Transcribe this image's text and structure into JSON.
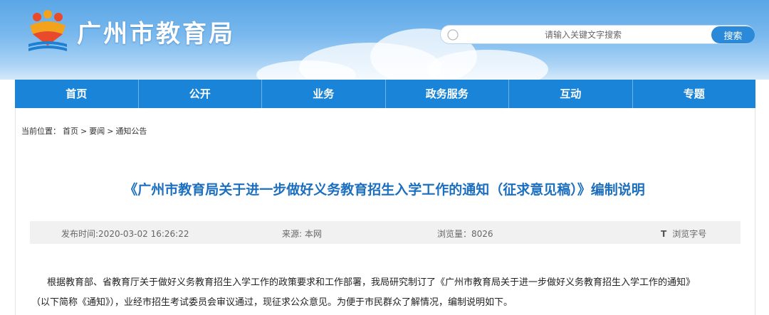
{
  "header": {
    "site_title": "广州市教育局",
    "logo_icon": "education-bureau-logo"
  },
  "search": {
    "placeholder": "请输入关键文字搜索",
    "button_label": "搜索",
    "icon": "search-icon"
  },
  "nav": {
    "items": [
      {
        "label": "首页"
      },
      {
        "label": "公开"
      },
      {
        "label": "业务"
      },
      {
        "label": "政务服务"
      },
      {
        "label": "互动"
      },
      {
        "label": "专题"
      }
    ]
  },
  "breadcrumb": {
    "prefix": "当前位置：",
    "items": [
      "首页",
      "要闻",
      "通知公告"
    ],
    "separator": ">"
  },
  "article": {
    "title": "《广州市教育局关于进一步做好义务教育招生入学工作的通知（征求意见稿）》编制说明",
    "meta": {
      "published": "发布时间:2020-03-02 16:26:22",
      "source": "来源: 本网",
      "views": "浏览量：8026",
      "text_toggle_icon": "T",
      "text_toggle_label": "浏览字号"
    },
    "paragraph_line1": "根据教育部、省教育厅关于做好义务教育招生入学工作的政策要求和工作部署，我局研究制订了《广州市教育局关于进一步做好义务教育招生入学工作的通知》",
    "paragraph_line2": "（以下简称《通知》），业经市招生考试委员会审议通过，现征求公众意见。为便于市民群众了解情况，编制说明如下。"
  },
  "colors": {
    "nav_blue": "#1a84d8",
    "title_blue": "#1c6fbe",
    "search_button": "#2a8ad9"
  }
}
